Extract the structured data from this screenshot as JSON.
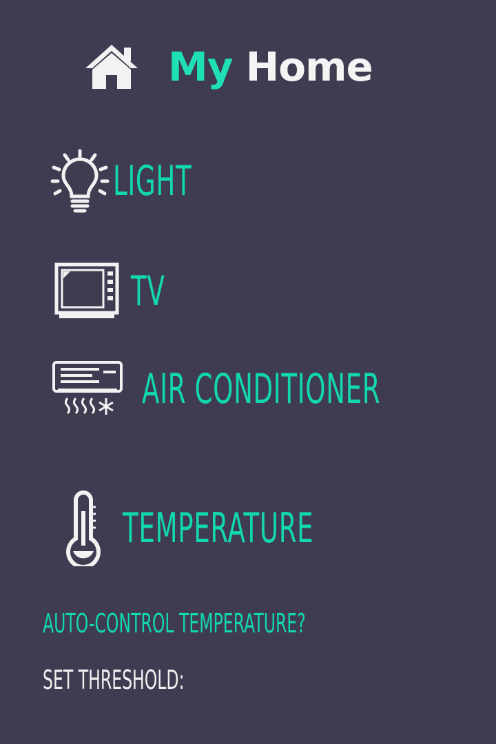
{
  "header": {
    "icon": "home-icon",
    "title_accent": "My",
    "title_rest": "Home"
  },
  "devices": [
    {
      "icon": "lightbulb-icon",
      "label": "LIGHT"
    },
    {
      "icon": "tv-icon",
      "label": "TV"
    },
    {
      "icon": "air-conditioner-icon",
      "label": "AIR CONDITIONER"
    },
    {
      "icon": "thermometer-icon",
      "label": "TEMPERATURE"
    }
  ],
  "auto_control": {
    "label": "AUTO-CONTROL TEMPERATURE?"
  },
  "threshold": {
    "label": "SET THRESHOLD:"
  },
  "colors": {
    "background": "#3f3c52",
    "accent": "#12d8ae",
    "text": "#f0f0f0"
  }
}
